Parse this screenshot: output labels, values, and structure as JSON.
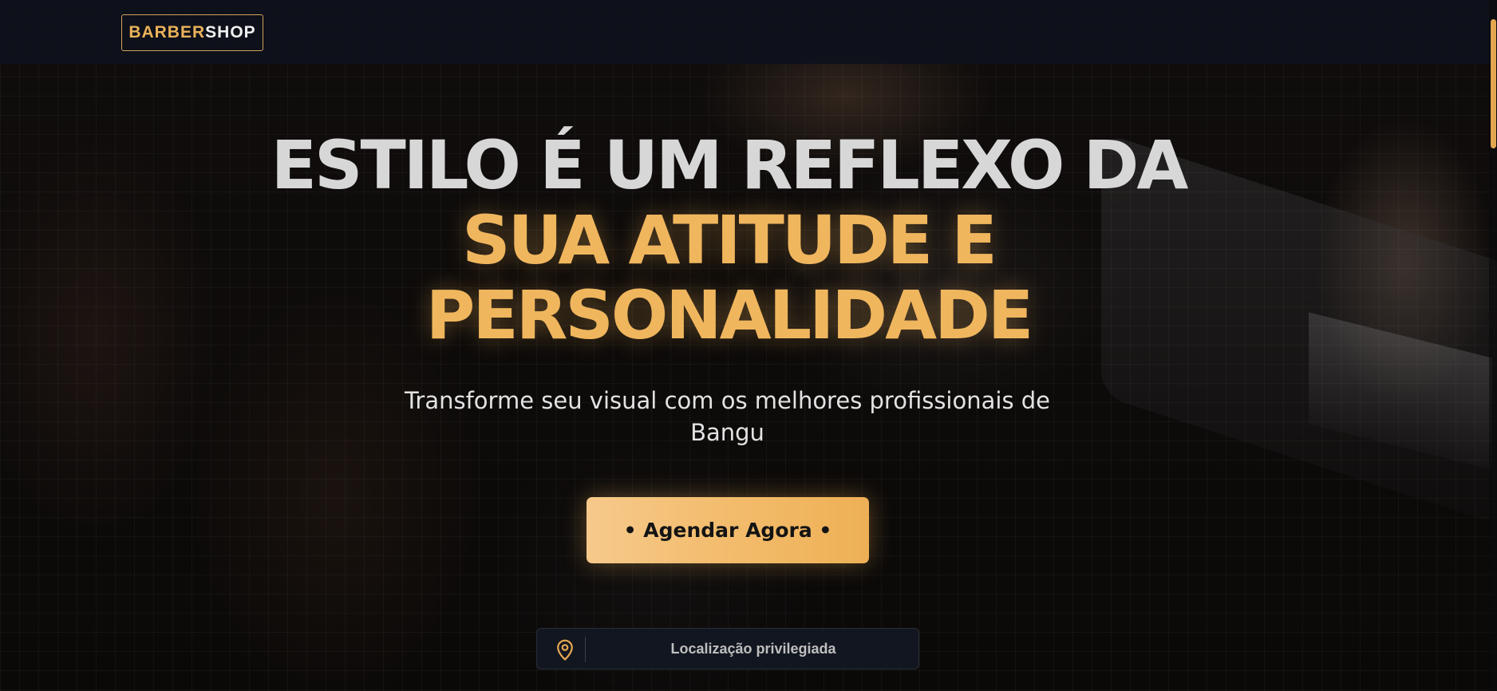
{
  "header": {
    "logo_part1": "BARBER",
    "logo_part2": "SHOP"
  },
  "hero": {
    "headline_line1": "ESTILO É UM REFLEXO DA",
    "headline_line2": "SUA ATITUDE E",
    "headline_line3": "PERSONALIDADE",
    "subtitle_line1": "Transforme seu visual com os melhores profissionais de",
    "subtitle_line2": "Bangu",
    "cta_label": "• Agendar Agora •",
    "feature_label": "Localização privilegiada",
    "feature_icon": "map-pin-icon"
  },
  "colors": {
    "accent": "#f0b65e",
    "header_bg": "#0e111c",
    "text_light": "#d7d7d7"
  }
}
